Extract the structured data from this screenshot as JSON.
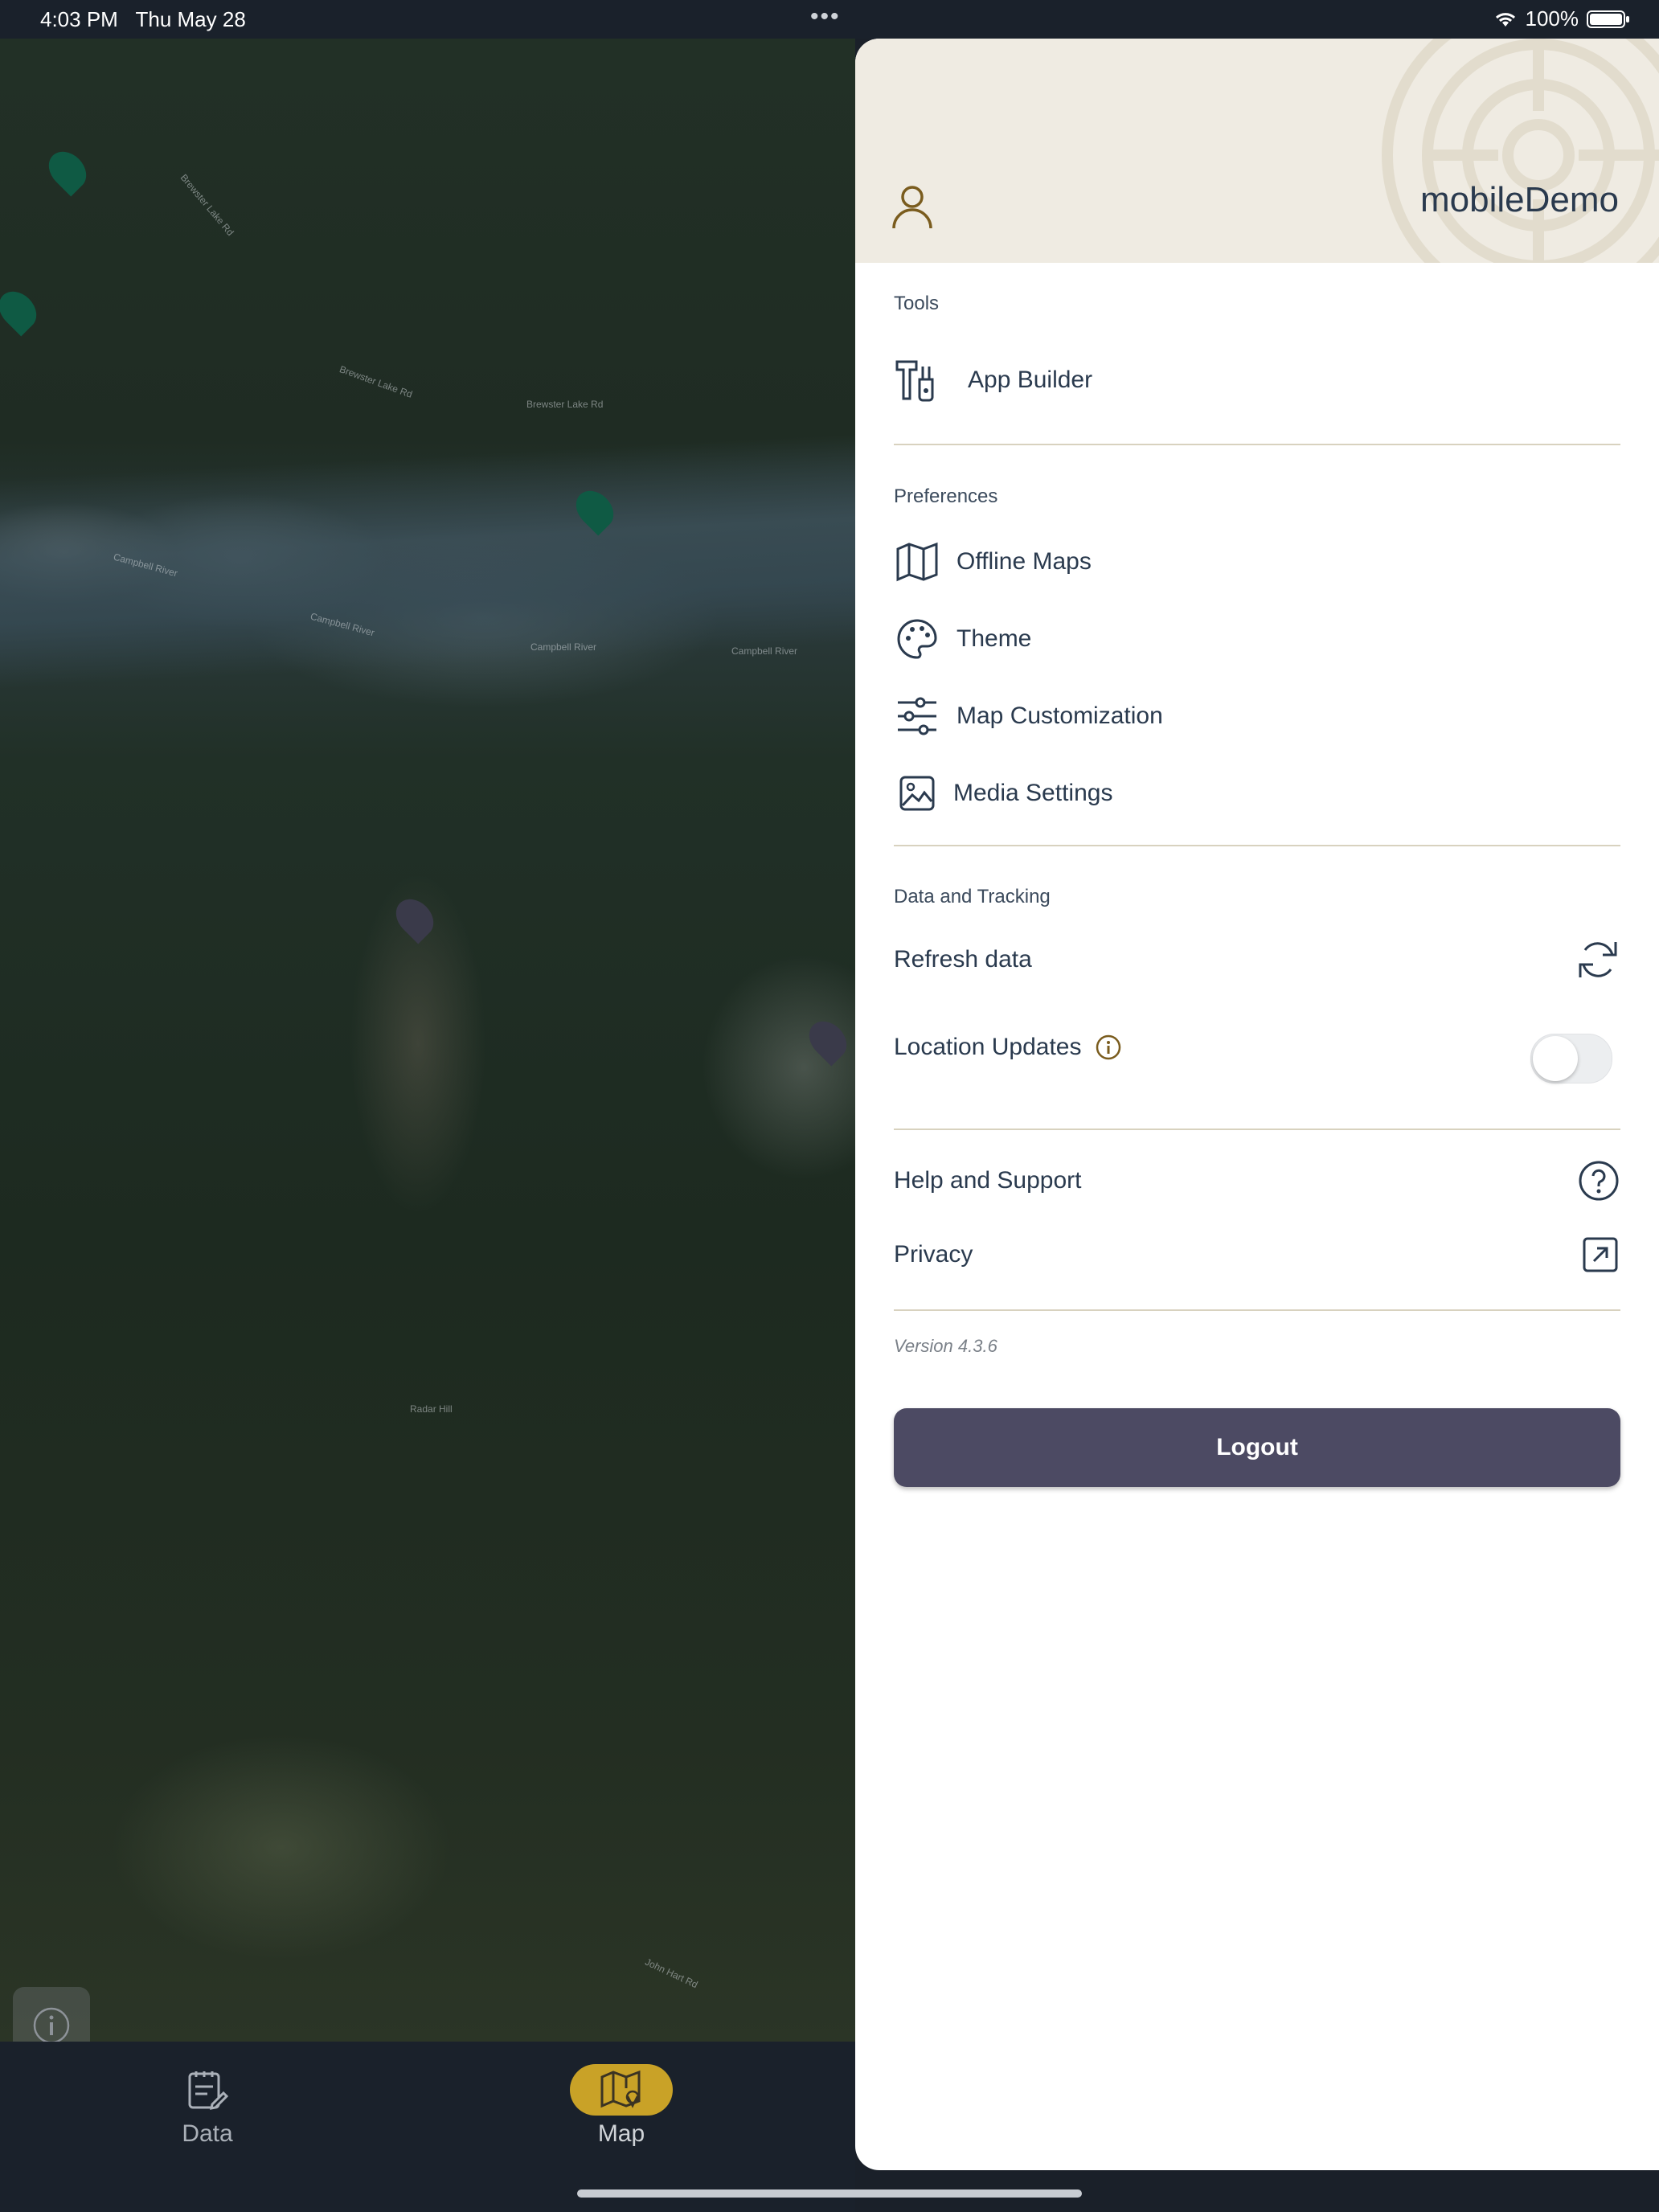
{
  "status_bar": {
    "time": "4:03 PM",
    "date": "Thu May 28",
    "battery": "100%"
  },
  "map": {
    "labels": [
      "Brewster Lake Rd",
      "Brewster Lake Rd",
      "Brewster Lake Rd",
      "Campbell River",
      "Campbell River",
      "Campbell River",
      "Campbell River",
      "Radar Hill",
      "John Hart Rd"
    ]
  },
  "tabs": [
    {
      "label": "Data",
      "icon": "data-icon",
      "active": false
    },
    {
      "label": "Map",
      "icon": "map-icon",
      "active": true
    }
  ],
  "drawer": {
    "username": "mobileDemo",
    "tools": {
      "title": "Tools",
      "items": [
        {
          "label": "App Builder",
          "icon": "tools-icon"
        }
      ]
    },
    "preferences": {
      "title": "Preferences",
      "items": [
        {
          "label": "Offline Maps",
          "icon": "map-icon"
        },
        {
          "label": "Theme",
          "icon": "palette-icon"
        },
        {
          "label": "Map Customization",
          "icon": "sliders-icon"
        },
        {
          "label": "Media Settings",
          "icon": "image-icon"
        }
      ]
    },
    "data_tracking": {
      "title": "Data and Tracking",
      "refresh_label": "Refresh data",
      "location_label": "Location Updates",
      "location_enabled": false
    },
    "help_label": "Help and Support",
    "privacy_label": "Privacy",
    "version": "Version 4.3.6",
    "logout_label": "Logout"
  },
  "colors": {
    "accent": "#c9a227",
    "logout_bg": "#4c4a63",
    "text": "#2a3a4e",
    "header_bg": "#efebe2"
  }
}
